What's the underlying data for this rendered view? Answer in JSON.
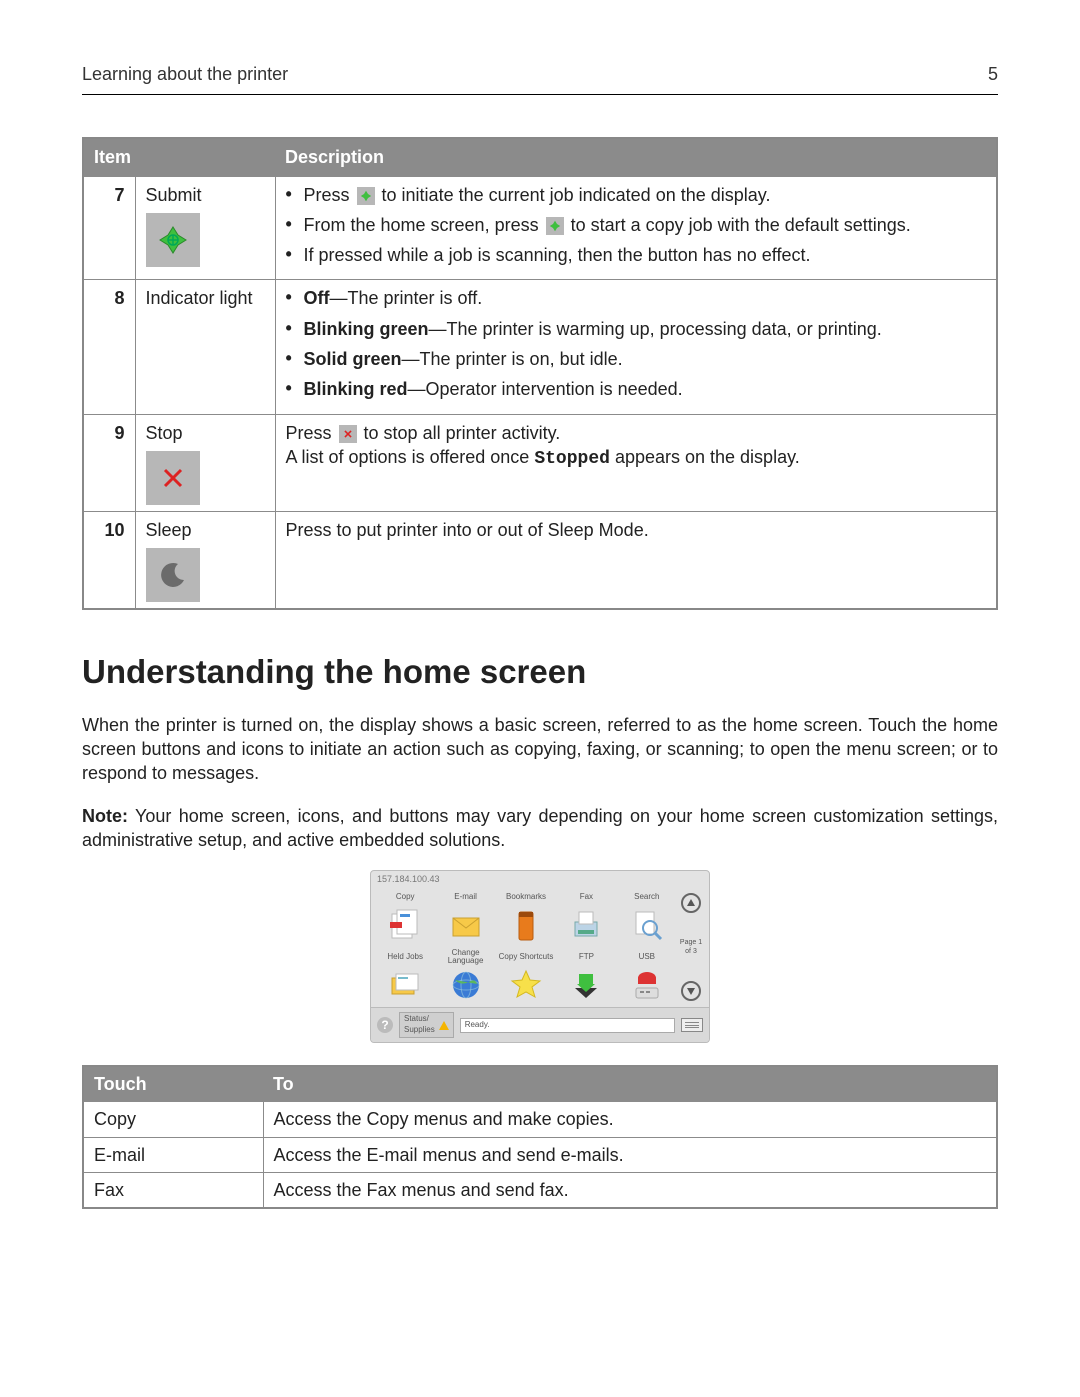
{
  "header": {
    "section": "Learning about the printer",
    "page": "5"
  },
  "table1": {
    "col1": "Item",
    "col2": "Description",
    "rows": [
      {
        "num": "7",
        "name": "Submit",
        "d1a": "Press ",
        "d1b": " to initiate the current job indicated on the display.",
        "d2a": "From the home screen, press ",
        "d2b": " to start a copy job with the default settings.",
        "d3": "If pressed while a job is scanning, then the button has no effect."
      },
      {
        "num": "8",
        "name": "Indicator light",
        "s1h": "Off",
        "s1t": "—The printer is off.",
        "s2h": "Blinking green",
        "s2t": "—The printer is warming up, processing data, or printing.",
        "s3h": "Solid green",
        "s3t": "—The printer is on, but idle.",
        "s4h": "Blinking red",
        "s4t": "—Operator intervention is needed."
      },
      {
        "num": "9",
        "name": "Stop",
        "d1a": "Press ",
        "d1b": " to stop all printer activity.",
        "d2a": "A list of options is offered once ",
        "d2m": "Stopped",
        "d2b": " appears on the display."
      },
      {
        "num": "10",
        "name": "Sleep",
        "d1": "Press to put printer into or out of Sleep Mode."
      }
    ]
  },
  "heading": "Understanding the home screen",
  "para1": "When the printer is turned on, the display shows a basic screen, referred to as the home screen. Touch the home screen buttons and icons to initiate an action such as copying, faxing, or scanning; to open the menu screen; or to respond to messages.",
  "para2a": "Note:",
  "para2b": " Your home screen, icons, and buttons may vary depending on your home screen customization settings, administrative setup, and active embedded solutions.",
  "hs": {
    "ip": "157.184.100.43",
    "row1": [
      "Copy",
      "E-mail",
      "Bookmarks",
      "Fax",
      "Search"
    ],
    "row2": [
      "Held Jobs",
      "Change Language",
      "Copy Shortcuts",
      "FTP",
      "USB"
    ],
    "page": "Page 1 of 3",
    "status_label": "Status/\nSupplies",
    "ready": "Ready."
  },
  "table2": {
    "col1": "Touch",
    "col2": "To",
    "rows": [
      {
        "t": "Copy",
        "d": "Access the Copy menus and make copies."
      },
      {
        "t": "E-mail",
        "d": "Access the E-mail menus and send e-mails."
      },
      {
        "t": "Fax",
        "d": "Access the Fax menus and send fax."
      }
    ]
  }
}
